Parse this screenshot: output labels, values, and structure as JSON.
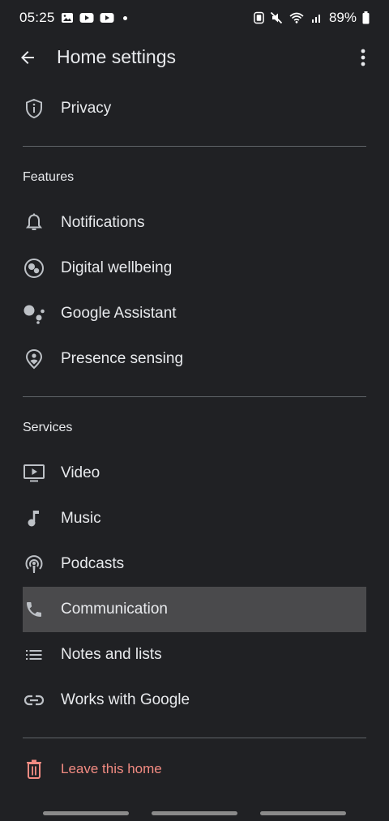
{
  "status_bar": {
    "time": "05:25",
    "battery": "89%"
  },
  "app_bar": {
    "title": "Home settings"
  },
  "sections": {
    "top": {
      "items": [
        {
          "label": "Privacy",
          "icon": "shield-info-icon"
        }
      ]
    },
    "features": {
      "header": "Features",
      "items": [
        {
          "label": "Notifications",
          "icon": "bell-icon"
        },
        {
          "label": "Digital wellbeing",
          "icon": "digital-wellbeing-icon"
        },
        {
          "label": "Google Assistant",
          "icon": "google-assistant-icon"
        },
        {
          "label": "Presence sensing",
          "icon": "presence-sensing-icon"
        }
      ]
    },
    "services": {
      "header": "Services",
      "items": [
        {
          "label": "Video",
          "icon": "video-icon"
        },
        {
          "label": "Music",
          "icon": "music-note-icon"
        },
        {
          "label": "Podcasts",
          "icon": "podcast-icon"
        },
        {
          "label": "Communication",
          "icon": "phone-icon",
          "selected": true
        },
        {
          "label": "Notes and lists",
          "icon": "list-icon"
        },
        {
          "label": "Works with Google",
          "icon": "link-icon"
        }
      ]
    },
    "danger": {
      "items": [
        {
          "label": "Leave this home",
          "icon": "trash-icon"
        }
      ]
    }
  },
  "colors": {
    "background": "#202124",
    "text": "#e8eaed",
    "divider": "#5f6368",
    "selected_row": "#4a4a4c",
    "danger": "#f28b82"
  }
}
